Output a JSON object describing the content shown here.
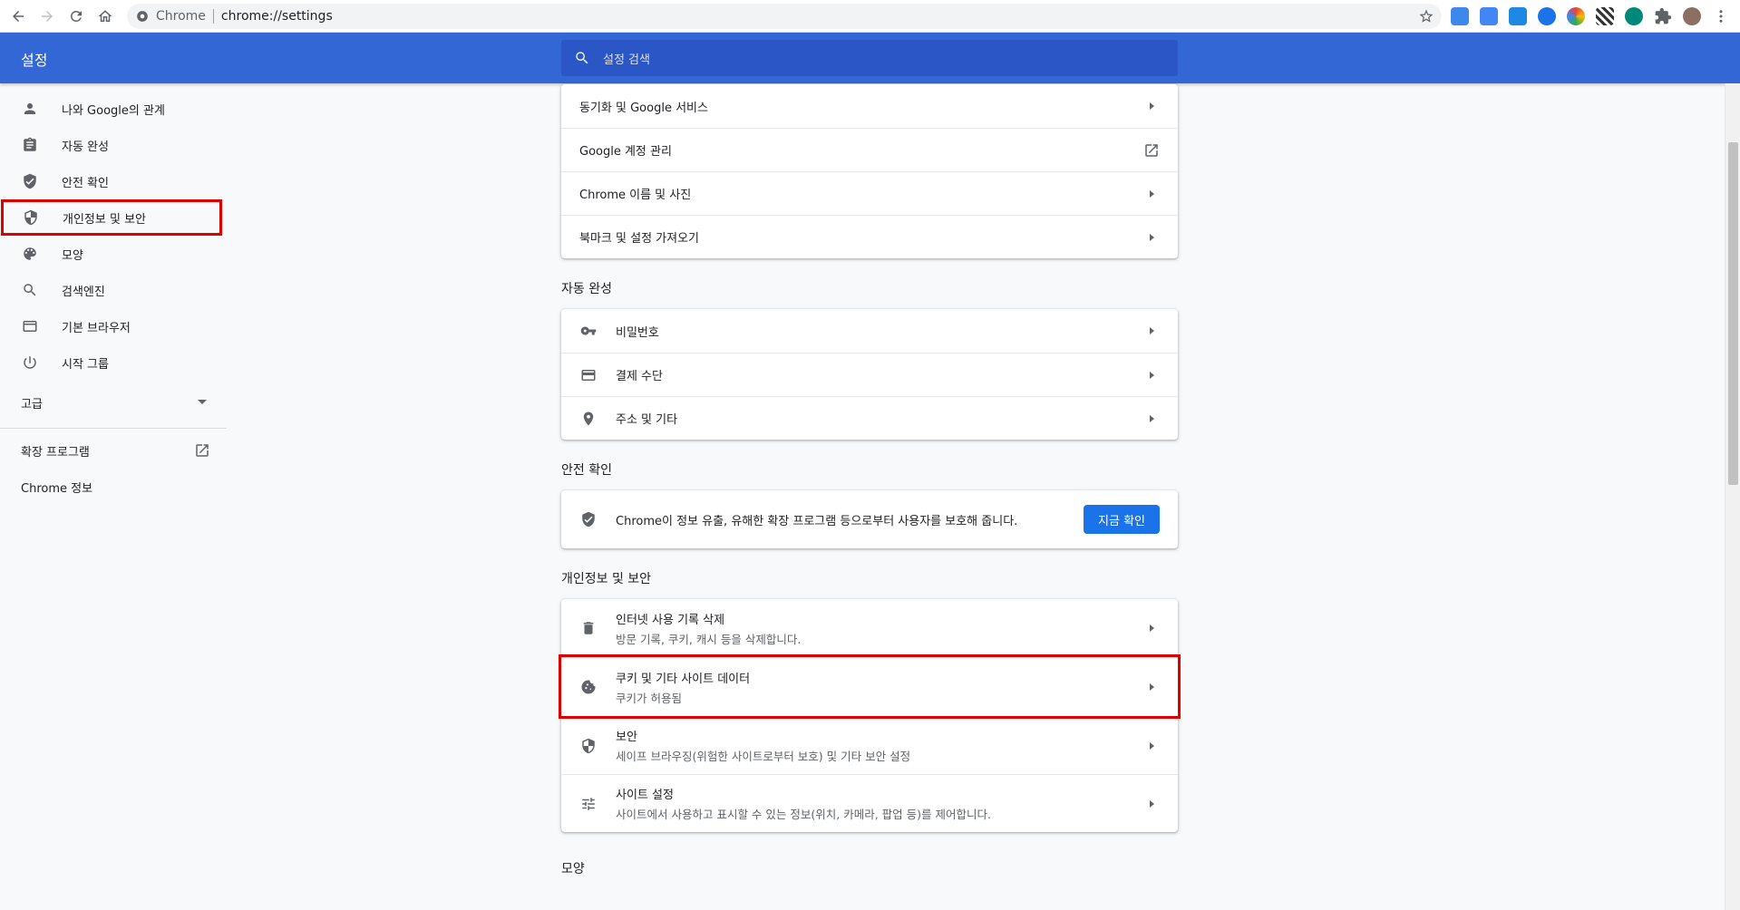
{
  "browser": {
    "site_chip": "Chrome",
    "url": "chrome://settings"
  },
  "header": {
    "title": "설정",
    "search_placeholder": "설정 검색"
  },
  "sidebar": {
    "items": [
      {
        "label": "나와 Google의 관계",
        "icon": "person-icon"
      },
      {
        "label": "자동 완성",
        "icon": "clipboard-icon"
      },
      {
        "label": "안전 확인",
        "icon": "shield-check-icon"
      },
      {
        "label": "개인정보 및 보안",
        "icon": "shield-icon"
      },
      {
        "label": "모양",
        "icon": "palette-icon"
      },
      {
        "label": "검색엔진",
        "icon": "search-icon"
      },
      {
        "label": "기본 브라우저",
        "icon": "browser-icon"
      },
      {
        "label": "시작 그룹",
        "icon": "power-icon"
      }
    ],
    "advanced": "고급",
    "extensions": "확장 프로그램",
    "about": "Chrome 정보"
  },
  "you_google": {
    "rows": [
      {
        "label": "동기화 및 Google 서비스"
      },
      {
        "label": "Google 계정 관리"
      },
      {
        "label": "Chrome 이름 및 사진"
      },
      {
        "label": "북마크 및 설정 가져오기"
      }
    ]
  },
  "autofill": {
    "title": "자동 완성",
    "rows": [
      {
        "label": "비밀번호",
        "icon": "key-icon"
      },
      {
        "label": "결제 수단",
        "icon": "credit-card-icon"
      },
      {
        "label": "주소 및 기타",
        "icon": "location-pin-icon"
      }
    ]
  },
  "safety": {
    "title": "안전 확인",
    "text": "Chrome이 정보 유출, 유해한 확장 프로그램 등으로부터 사용자를 보호해 줍니다.",
    "button": "지금 확인"
  },
  "privacy": {
    "title": "개인정보 및 보안",
    "rows": [
      {
        "label": "인터넷 사용 기록 삭제",
        "sub": "방문 기록, 쿠키, 캐시 등을 삭제합니다.",
        "icon": "trash-icon"
      },
      {
        "label": "쿠키 및 기타 사이트 데이터",
        "sub": "쿠키가 허용됨",
        "icon": "cookie-icon"
      },
      {
        "label": "보안",
        "sub": "세이프 브라우징(위험한 사이트로부터 보호) 및 기타 보안 설정",
        "icon": "shield-icon"
      },
      {
        "label": "사이트 설정",
        "sub": "사이트에서 사용하고 표시할 수 있는 정보(위치, 카메라, 팝업 등)를 제어합니다.",
        "icon": "tune-icon"
      }
    ]
  },
  "appearance": {
    "title": "모양"
  }
}
